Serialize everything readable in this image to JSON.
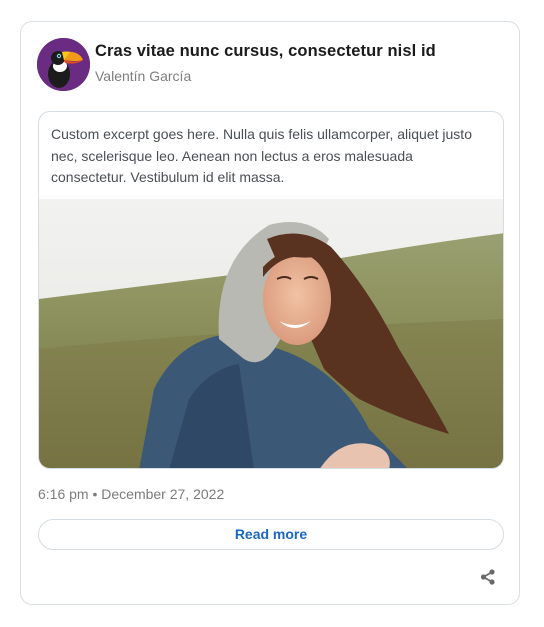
{
  "post": {
    "title": "Cras vitae nunc cursus, consectetur nisl id",
    "author": "Valentín García",
    "excerpt": "Custom excerpt goes here. Nulla quis felis ullamcorper, aliquet justo nec, scelerisque leo. Aenean non lectus a eros malesuada consectetur. Vestibulum id elit massa.",
    "timestamp": "6:16 pm • December 27, 2022",
    "read_more_label": "Read more"
  },
  "icons": {
    "avatar": "toucan-avatar-icon",
    "share": "share-icon"
  },
  "colors": {
    "link": "#1a67c5",
    "avatar_bg": "#6a2c82"
  }
}
